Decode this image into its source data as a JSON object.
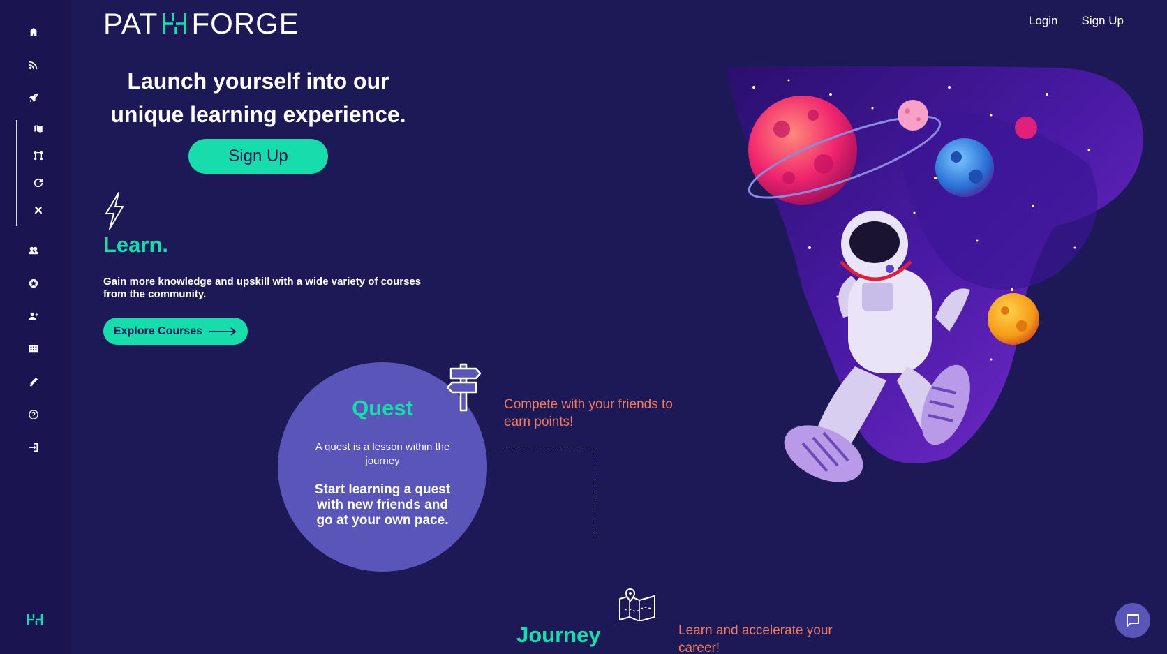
{
  "brand": {
    "left": "PAT",
    "right": "FORGE"
  },
  "topnav": {
    "login": "Login",
    "signup": "Sign Up"
  },
  "sidebar": {
    "items": [
      {
        "icon": "home-icon"
      },
      {
        "icon": "feed-icon"
      },
      {
        "icon": "rocket-icon"
      },
      {
        "icon": "map-icon"
      },
      {
        "icon": "path-icon"
      },
      {
        "icon": "refresh-icon"
      },
      {
        "icon": "tools-icon"
      },
      {
        "icon": "users-icon"
      },
      {
        "icon": "star-icon"
      },
      {
        "icon": "user-add-icon"
      },
      {
        "icon": "building-icon"
      },
      {
        "icon": "pencil-icon"
      },
      {
        "icon": "help-icon"
      },
      {
        "icon": "login-icon"
      }
    ]
  },
  "hero": {
    "title": "Launch yourself into our unique learning experience.",
    "signup_button": "Sign Up"
  },
  "learn": {
    "title": "Learn.",
    "description": "Gain more knowledge and upskill with a wide variety of courses from the community.",
    "button": "Explore Courses"
  },
  "quest": {
    "title": "Quest",
    "subtitle": "A quest is a lesson within the journey",
    "main": "Start learning a quest with new friends and go at your own pace.",
    "tagline": "Compete with your friends to earn points!"
  },
  "journey": {
    "title": "Journey",
    "tagline": "Learn and accelerate your career!"
  },
  "colors": {
    "background": "#1d1856",
    "accent": "#17dcac",
    "circle": "#5a55b8",
    "orange_text": "#f27a5e"
  }
}
